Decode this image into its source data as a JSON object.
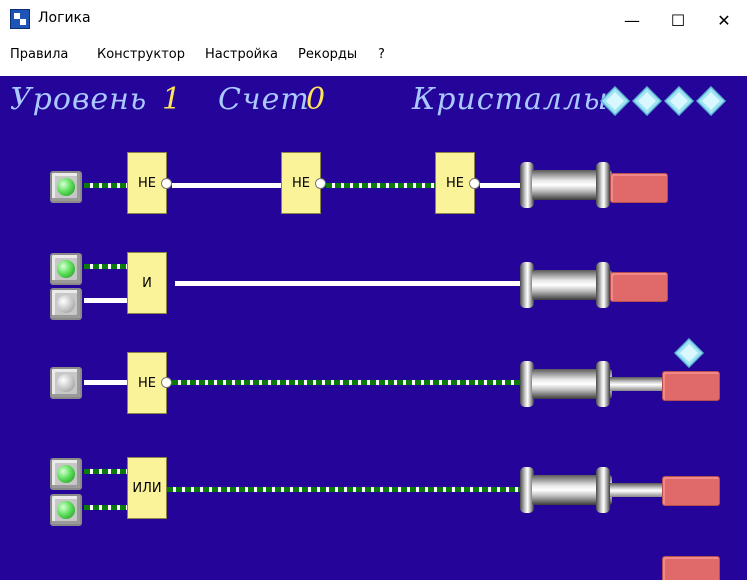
{
  "window": {
    "title": "Логика",
    "controls": {
      "minimize": "—",
      "maximize": "☐",
      "close": "✕"
    }
  },
  "menu": {
    "items": [
      "Правила",
      "Конструктор",
      "Настройка",
      "Рекорды",
      "?"
    ]
  },
  "hud": {
    "level_label": "Уровень",
    "level_value": "1",
    "score_label": "Счет",
    "score_value": "0",
    "crystals_label": "Кристаллы",
    "crystals_count": 4
  },
  "rows": [
    {
      "inputs": [
        true
      ],
      "gates": [
        "НЕ",
        "НЕ",
        "НЕ"
      ],
      "output_on": false
    },
    {
      "inputs": [
        true,
        false
      ],
      "gates": [
        "И"
      ],
      "output_on": false
    },
    {
      "inputs": [
        false
      ],
      "gates": [
        "НЕ"
      ],
      "output_on": true,
      "crystal_on_block": true
    },
    {
      "inputs": [
        true,
        true
      ],
      "gates": [
        "ИЛИ"
      ],
      "output_on": true
    }
  ],
  "colors": {
    "background": "#25049a",
    "hud_text": "#a9c9ff",
    "hud_number": "#ffe35a",
    "gate_fill": "#fbf39a",
    "wire_active": "#0a7a0a",
    "wire_inactive": "#ffffff",
    "block": "#e06a6a"
  }
}
